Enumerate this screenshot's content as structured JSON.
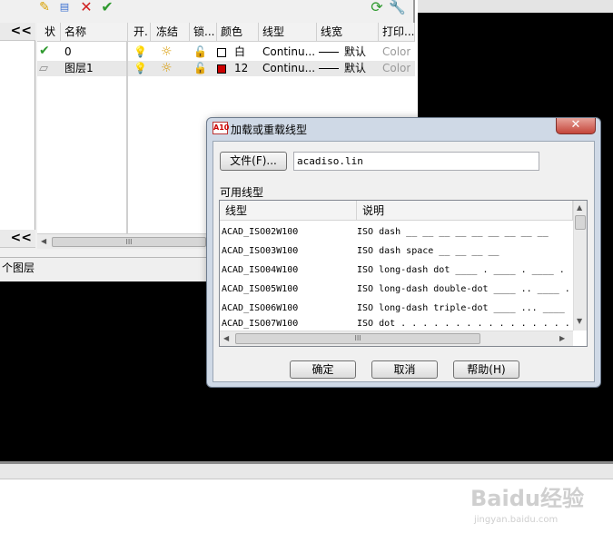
{
  "layer_manager": {
    "toolbar_icons": [
      "new-layer-icon",
      "new-layer-vp-frozen-icon",
      "delete-layer-icon",
      "set-current-icon"
    ],
    "right_toolbar_icons": [
      "refresh-icon",
      "settings-icon"
    ],
    "collapse_glyph": "<<",
    "columns": [
      "状",
      "名称",
      "开.",
      "冻结",
      "锁...",
      "颜色",
      "线型",
      "线宽",
      "打印..."
    ],
    "rows": [
      {
        "status_icon": "current-check-icon",
        "name": "0",
        "color_name": "白",
        "color_hex": "#ffffff",
        "linetype": "Continu...",
        "lineweight": "默认",
        "plot": "Color"
      },
      {
        "status_icon": "layer-icon",
        "name": "图层1",
        "color_name": "12",
        "color_hex": "#cc0000",
        "linetype": "Continu...",
        "lineweight": "默认",
        "plot": "Color"
      }
    ],
    "scroll_thumb": "III",
    "status_text": "个图层"
  },
  "dialog": {
    "title": "加载或重载线型",
    "app_icon_text": "A10",
    "close_glyph": "✕",
    "file_button": "文件(F)...",
    "file_path": "acadiso.lin",
    "available_label": "可用线型",
    "columns": [
      "线型",
      "说明"
    ],
    "linetypes": [
      {
        "name": "ACAD_ISO02W100",
        "desc": "ISO dash __ __ __ __ __ __ __ __ __"
      },
      {
        "name": "ACAD_ISO03W100",
        "desc": "ISO dash space __    __    __    __"
      },
      {
        "name": "ACAD_ISO04W100",
        "desc": "ISO long-dash dot ____ . ____ . ____ ."
      },
      {
        "name": "ACAD_ISO05W100",
        "desc": "ISO long-dash double-dot ____ .. ____ ."
      },
      {
        "name": "ACAD_ISO06W100",
        "desc": "ISO long-dash triple-dot ____ ... ____"
      },
      {
        "name": "ACAD_ISO07W100",
        "desc": "ISO dot . . . . . . . . . . . . . . . ."
      }
    ],
    "scroll_thumb": "III",
    "ok_button": "确定",
    "cancel_button": "取消",
    "help_button": "帮助(H)"
  },
  "watermark": {
    "brand": "Baidu经验",
    "url": "jingyan.baidu.com"
  },
  "colors": {
    "accent_check": "#2f9a2f",
    "delete_red": "#d02020",
    "desktop_black": "#000000",
    "dialog_frame": "#cfd9e6"
  }
}
